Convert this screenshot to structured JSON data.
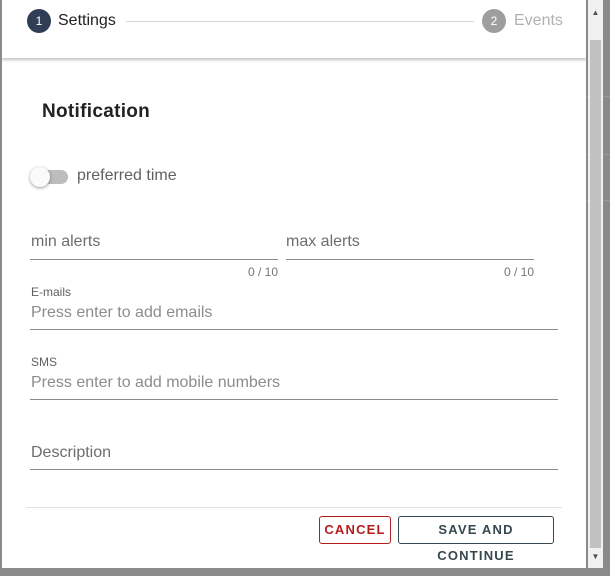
{
  "stepper": {
    "steps": [
      {
        "number": "1",
        "label": "Settings",
        "active": true
      },
      {
        "number": "2",
        "label": "Events",
        "active": false
      }
    ]
  },
  "section": {
    "title": "Notification"
  },
  "toggle": {
    "label": "preferred time",
    "checked": false
  },
  "fields": {
    "min_alerts": {
      "label": "min alerts",
      "counter": "0 / 10",
      "value": ""
    },
    "max_alerts": {
      "label": "max alerts",
      "counter": "0 / 10",
      "value": ""
    },
    "emails": {
      "label": "E-mails",
      "placeholder": "Press enter to add emails"
    },
    "sms": {
      "label": "SMS",
      "placeholder": "Press enter to add mobile numbers"
    },
    "description": {
      "label": "Description",
      "value": ""
    }
  },
  "actions": {
    "cancel_label": "CANCEL",
    "save_label": "SAVE AND CONTINUE"
  },
  "colors": {
    "step_active": "#2f3e55",
    "step_inactive": "#9e9e9e",
    "cancel": "#b71c1c",
    "save": "#37474f"
  },
  "icons": {
    "scroll_up": "triangle-up-icon",
    "scroll_down": "triangle-down-icon"
  }
}
